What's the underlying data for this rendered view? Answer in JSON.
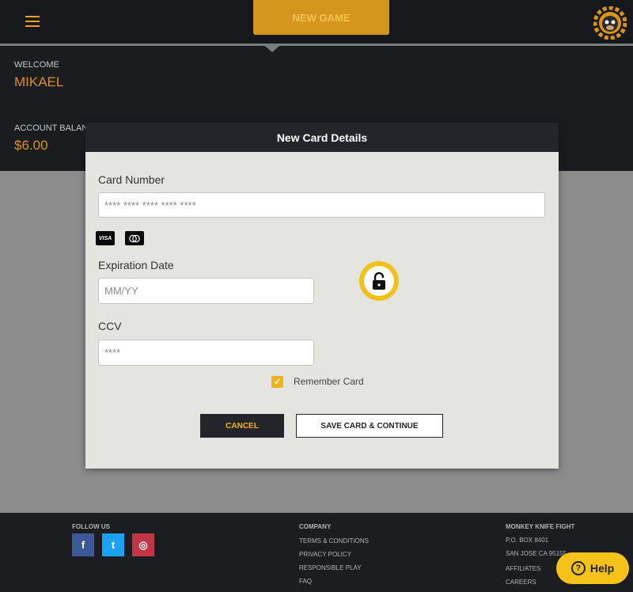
{
  "topbar": {
    "new_game_label": "NEW GAME"
  },
  "account": {
    "welcome_label": "WELCOME",
    "user_name": "MIKAEL",
    "balance_label": "ACCOUNT BALANCE",
    "balance_value": "$6.00"
  },
  "modal": {
    "title": "New Card Details",
    "card_number_label": "Card Number",
    "card_number_placeholder": "**** **** **** **** ****",
    "card_brands": [
      "VISA",
      "mastercard"
    ],
    "expiration_label": "Expiration Date",
    "expiration_placeholder": "MM/YY",
    "ccv_label": "CCV",
    "ccv_placeholder": "****",
    "remember_label": "Remember Card",
    "remember_checked": true,
    "cancel_label": "CANCEL",
    "save_label": "SAVE CARD & CONTINUE"
  },
  "footer": {
    "follow_heading": "FOLLOW US",
    "company_heading": "COMPANY",
    "company_links": [
      "TERMS & CONDITIONS",
      "PRIVACY POLICY",
      "RESPONSIBLE PLAY",
      "FAQ"
    ],
    "brand_heading": "MONKEY KNIFE FIGHT",
    "address_line1": "P.O. BOX 8401",
    "address_line2": "SAN JOSE CA 95155",
    "brand_links": [
      "AFFILIATES",
      "CAREERS"
    ],
    "socials": [
      {
        "name": "facebook",
        "glyph": "f",
        "color": "#3b5998"
      },
      {
        "name": "twitter",
        "glyph": "t",
        "color": "#1da1f2"
      },
      {
        "name": "instagram",
        "glyph": "◎",
        "color": "#c13545"
      }
    ]
  },
  "help": {
    "label": "Help",
    "glyph": "?"
  },
  "colors": {
    "accent": "#f2b21a",
    "dark": "#24252a"
  }
}
